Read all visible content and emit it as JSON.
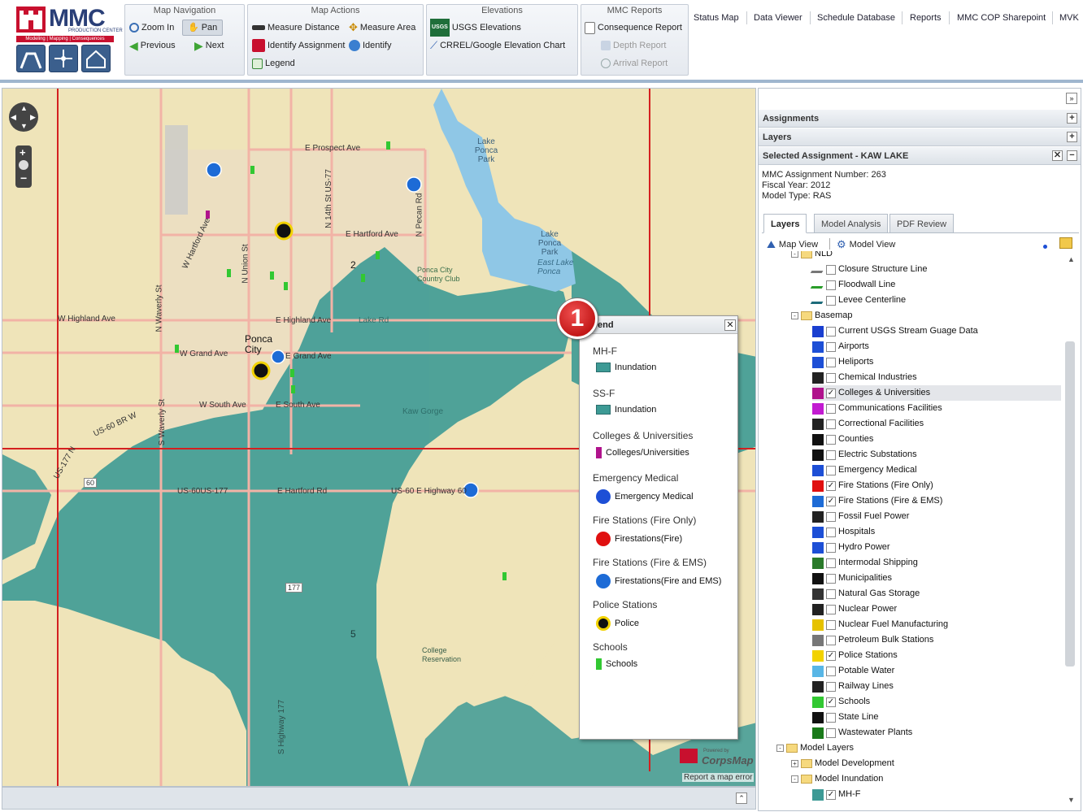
{
  "app": {
    "logo_text": "MMC",
    "logo_subtitle": "PRODUCTION CENTER",
    "logo_tagline": "Modeling | Mapping | Consequences"
  },
  "toolbar": {
    "map_navigation": {
      "title": "Map Navigation",
      "zoom_in": "Zoom In",
      "pan": "Pan",
      "previous": "Previous",
      "next": "Next"
    },
    "map_actions": {
      "title": "Map Actions",
      "measure_distance": "Measure Distance",
      "measure_area": "Measure Area",
      "identify_assignment": "Identify Assignment",
      "identify": "Identify",
      "legend": "Legend"
    },
    "elevations": {
      "title": "Elevations",
      "usgs": "USGS Elevations",
      "usgs_badge": "USGS",
      "crrel": "CRREL/Google Elevation Chart"
    },
    "mmc_reports": {
      "title": "MMC Reports",
      "consequence": "Consequence Report",
      "depth": "Depth Report",
      "arrival": "Arrival Report"
    }
  },
  "nav": [
    "Status Map",
    "Data Viewer",
    "Schedule Database",
    "Reports",
    "MMC COP Sharepoint",
    "MVK"
  ],
  "map": {
    "labels": [
      "E Prospect Ave",
      "Lake Ponca Park",
      "E Hartford Ave",
      "Lake Ponca Park",
      "East Lake Ponca",
      "Ponca City Country Club",
      "W Highland Ave",
      "E Highland Ave",
      "Lake Rd",
      "W Grand Ave",
      "E Grand Ave",
      "Ponca City",
      "W South Ave",
      "E South Ave",
      "US-60 BR W",
      "US-60US-177",
      "E Hartford Rd",
      "US-60 E Highway 60",
      "W Hartford Ave",
      "N Union St",
      "N 14th St US-77",
      "N Pecan Rd",
      "N Waverly St",
      "S Waverly St",
      "S Highway 177",
      "Kaw Gorge",
      "College Reservation",
      "US-177 N",
      "2",
      "5",
      "177",
      "60"
    ],
    "credit": "Report a map error",
    "powered_by": "Powered by",
    "brand": "CorpsMap"
  },
  "panel": {
    "assignments": "Assignments",
    "layers": "Layers",
    "selected": "Selected Assignment - KAW LAKE",
    "assignment_number": "MMC Assignment Number: 263",
    "fiscal_year": "Fiscal Year: 2012",
    "model_type": "Model Type: RAS",
    "tabs": [
      "Layers",
      "Model Analysis",
      "PDF Review"
    ],
    "map_view": "Map View",
    "model_view": "Model View"
  },
  "tree": [
    {
      "label": "NLD",
      "kind": "folder",
      "indent": 0,
      "exp": "-"
    },
    {
      "label": "Closure Structure Line",
      "kind": "layer",
      "indent": 1,
      "checked": false,
      "icon": "line-gray-icon",
      "color": "#777777"
    },
    {
      "label": "Floodwall Line",
      "kind": "layer",
      "indent": 1,
      "checked": false,
      "icon": "line-green-icon",
      "color": "#2a9d2a"
    },
    {
      "label": "Levee Centerline",
      "kind": "layer",
      "indent": 1,
      "checked": false,
      "icon": "line-teal-icon",
      "color": "#1d6b7a"
    },
    {
      "label": "Basemap",
      "kind": "folder",
      "indent": 0,
      "exp": "-"
    },
    {
      "label": "Current USGS Stream Guage Data",
      "kind": "layer",
      "indent": 1,
      "checked": false,
      "icon": "dots-icon",
      "color": "#1a3fd0"
    },
    {
      "label": "Airports",
      "kind": "layer",
      "indent": 1,
      "checked": false,
      "icon": "airport-icon",
      "color": "#1d4fd6"
    },
    {
      "label": "Heliports",
      "kind": "layer",
      "indent": 1,
      "checked": false,
      "icon": "heliport-icon",
      "color": "#1d4fd6"
    },
    {
      "label": "Chemical Industries",
      "kind": "layer",
      "indent": 1,
      "checked": false,
      "icon": "chemical-icon",
      "color": "#222222"
    },
    {
      "label": "Colleges & Universities",
      "kind": "layer",
      "indent": 1,
      "checked": true,
      "icon": "college-icon",
      "color": "#b0138c",
      "selected": true
    },
    {
      "label": "Communications Facilities",
      "kind": "layer",
      "indent": 1,
      "checked": false,
      "icon": "antenna-icon",
      "color": "#c21bd1"
    },
    {
      "label": "Correctional Facilities",
      "kind": "layer",
      "indent": 1,
      "checked": false,
      "icon": "prison-icon",
      "color": "#222222"
    },
    {
      "label": "Counties",
      "kind": "layer",
      "indent": 1,
      "checked": false,
      "icon": "county-icon",
      "color": "#111111"
    },
    {
      "label": "Electric Substations",
      "kind": "layer",
      "indent": 1,
      "checked": false,
      "icon": "bolt-icon",
      "color": "#111111"
    },
    {
      "label": "Emergency Medical",
      "kind": "layer",
      "indent": 1,
      "checked": false,
      "icon": "star-of-life-icon",
      "color": "#1d4fd6"
    },
    {
      "label": "Fire Stations (Fire Only)",
      "kind": "layer",
      "indent": 1,
      "checked": true,
      "icon": "fire-red-icon",
      "color": "#e01010"
    },
    {
      "label": "Fire Stations (Fire & EMS)",
      "kind": "layer",
      "indent": 1,
      "checked": true,
      "icon": "fire-blue-icon",
      "color": "#1d6bd6"
    },
    {
      "label": "Fossil Fuel Power",
      "kind": "layer",
      "indent": 1,
      "checked": false,
      "icon": "factory-icon",
      "color": "#222222"
    },
    {
      "label": "Hospitals",
      "kind": "layer",
      "indent": 1,
      "checked": false,
      "icon": "hospital-icon",
      "color": "#1d4fd6"
    },
    {
      "label": "Hydro Power",
      "kind": "layer",
      "indent": 1,
      "checked": false,
      "icon": "hydro-icon",
      "color": "#1d4fd6"
    },
    {
      "label": "Intermodal Shipping",
      "kind": "layer",
      "indent": 1,
      "checked": false,
      "icon": "shipping-icon",
      "color": "#2a7a2a"
    },
    {
      "label": "Municipalities",
      "kind": "layer",
      "indent": 1,
      "checked": false,
      "icon": "municipal-icon",
      "color": "#111111"
    },
    {
      "label": "Natural Gas Storage",
      "kind": "layer",
      "indent": 1,
      "checked": false,
      "icon": "gas-icon",
      "color": "#333333"
    },
    {
      "label": "Nuclear Power",
      "kind": "layer",
      "indent": 1,
      "checked": false,
      "icon": "nuclear-power-icon",
      "color": "#222222"
    },
    {
      "label": "Nuclear Fuel Manufacturing",
      "kind": "layer",
      "indent": 1,
      "checked": false,
      "icon": "radiation-icon",
      "color": "#e6c200"
    },
    {
      "label": "Petroleum Bulk Stations",
      "kind": "layer",
      "indent": 1,
      "checked": false,
      "icon": "petroleum-icon",
      "color": "#777777"
    },
    {
      "label": "Police Stations",
      "kind": "layer",
      "indent": 1,
      "checked": true,
      "icon": "police-icon",
      "color": "#f2d200"
    },
    {
      "label": "Potable Water",
      "kind": "layer",
      "indent": 1,
      "checked": false,
      "icon": "water-icon",
      "color": "#58b6e6"
    },
    {
      "label": "Railway Lines",
      "kind": "layer",
      "indent": 1,
      "checked": false,
      "icon": "rail-icon",
      "color": "#222222"
    },
    {
      "label": "Schools",
      "kind": "layer",
      "indent": 1,
      "checked": true,
      "icon": "school-icon",
      "color": "#32c832"
    },
    {
      "label": "State Line",
      "kind": "layer",
      "indent": 1,
      "checked": false,
      "icon": "state-line-icon",
      "color": "#111111"
    },
    {
      "label": "Wastewater Plants",
      "kind": "layer",
      "indent": 1,
      "checked": false,
      "icon": "wastewater-icon",
      "color": "#1a7a1a"
    },
    {
      "label": "Model Layers",
      "kind": "folder",
      "indent": -1,
      "exp": "-"
    },
    {
      "label": "Model Development",
      "kind": "folder",
      "indent": 0,
      "exp": "+"
    },
    {
      "label": "Model Inundation",
      "kind": "folder",
      "indent": 0,
      "exp": "-"
    },
    {
      "label": "MH-F",
      "kind": "layer",
      "indent": 1,
      "checked": true,
      "icon": "inundation-icon",
      "color": "#3d9a95"
    }
  ],
  "legend": {
    "title": "Legend",
    "title_visible": "end",
    "groups": [
      {
        "heading": "MH-F",
        "item": "Inundation",
        "icon": "inundation-swatch-icon"
      },
      {
        "heading": "SS-F",
        "item": "Inundation",
        "icon": "inundation-swatch-icon"
      },
      {
        "heading": "Colleges & Universities",
        "item": "Colleges/Universities",
        "icon": "college-icon"
      },
      {
        "heading": "Emergency Medical",
        "item": "Emergency Medical",
        "icon": "star-of-life-icon"
      },
      {
        "heading": "Fire Stations (Fire Only)",
        "item": "Firestations(Fire)",
        "icon": "fire-red-icon"
      },
      {
        "heading": "Fire Stations (Fire & EMS)",
        "item": "Firestations(Fire and EMS)",
        "icon": "fire-blue-icon"
      },
      {
        "heading": "Police Stations",
        "item": "Police",
        "icon": "police-icon"
      },
      {
        "heading": "Schools",
        "item": "Schools",
        "icon": "school-icon"
      }
    ]
  },
  "callouts": [
    "1",
    "2"
  ],
  "colors": {
    "water": "#3d9a95",
    "land": "#efe4b9",
    "lake": "#8fc7e6",
    "road": "#f2b3a6",
    "boundary": "#d42020",
    "brand_red": "#c8102e",
    "brand_blue": "#2a3f77"
  }
}
